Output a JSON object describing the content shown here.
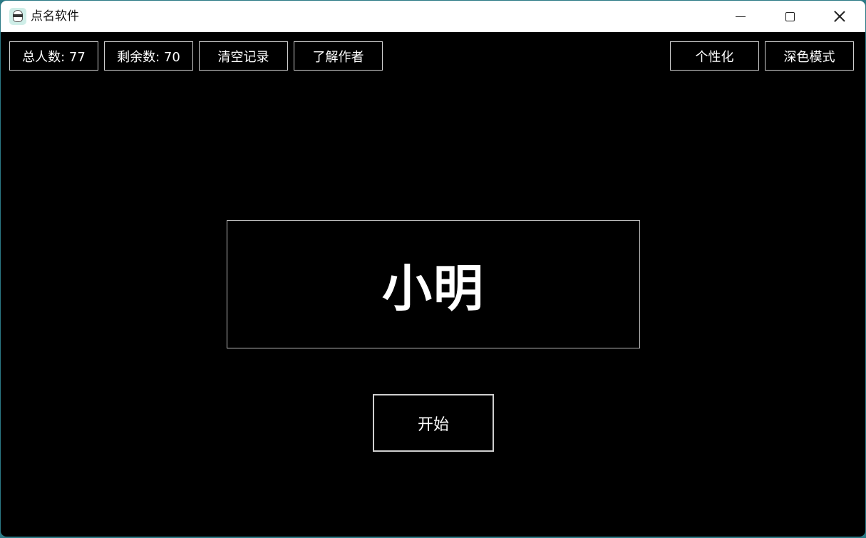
{
  "window": {
    "title": "点名软件",
    "controls": {
      "minimize_icon": "minimize-icon",
      "maximize_icon": "maximize-icon",
      "close_icon": "close-icon"
    }
  },
  "toolbar": {
    "total": "总人数: 77",
    "remaining": "剩余数: 70",
    "clear": "清空记录",
    "about": "了解作者",
    "personalize": "个性化",
    "dark_mode": "深色模式"
  },
  "main": {
    "selected_name": "小明",
    "start_label": "开始"
  },
  "colors": {
    "background": "#000000",
    "titlebar": "#ffffff",
    "text": "#ffffff",
    "border": "#cfcfcf",
    "desktop": "#2b7a86"
  }
}
